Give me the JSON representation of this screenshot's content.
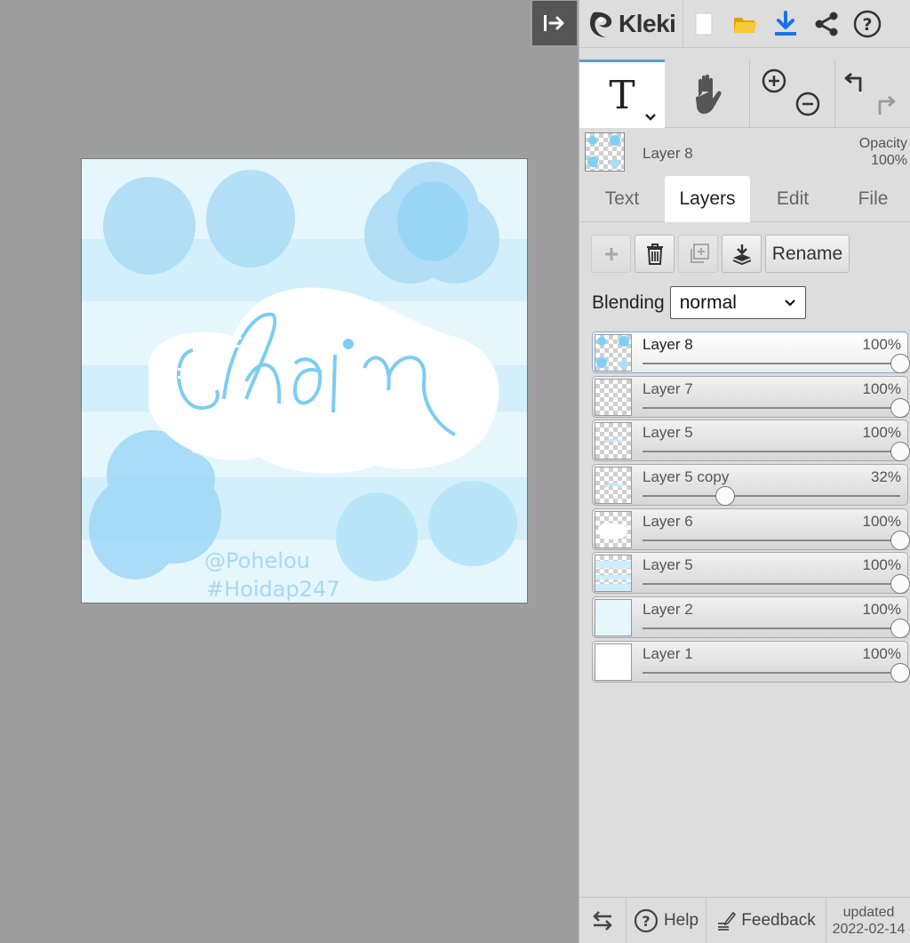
{
  "app": {
    "name": "Kleki"
  },
  "toolbar": {
    "active_tool": "T"
  },
  "layer_summary": {
    "name": "Layer 8",
    "opacity_label": "Opacity",
    "opacity_value": "100%"
  },
  "tabs": [
    {
      "label": "Text",
      "active": false
    },
    {
      "label": "Layers",
      "active": true
    },
    {
      "label": "Edit",
      "active": false
    },
    {
      "label": "File",
      "active": false
    }
  ],
  "layer_actions": {
    "rename_label": "Rename"
  },
  "blending": {
    "label": "Blending",
    "value": "normal"
  },
  "layers": [
    {
      "name": "Layer 8",
      "opacity": "100%",
      "level": 1.0,
      "active": true,
      "thumb": "dots"
    },
    {
      "name": "Layer 7",
      "opacity": "100%",
      "level": 1.0,
      "active": false,
      "thumb": "empty"
    },
    {
      "name": "Layer 5",
      "opacity": "100%",
      "level": 1.0,
      "active": false,
      "thumb": "faint"
    },
    {
      "name": "Layer 5 copy",
      "opacity": "32%",
      "level": 0.32,
      "active": false,
      "thumb": "faint"
    },
    {
      "name": "Layer 6",
      "opacity": "100%",
      "level": 1.0,
      "active": false,
      "thumb": "white"
    },
    {
      "name": "Layer 5",
      "opacity": "100%",
      "level": 1.0,
      "active": false,
      "thumb": "stripes"
    },
    {
      "name": "Layer 2",
      "opacity": "100%",
      "level": 1.0,
      "active": false,
      "thumb": "pale"
    },
    {
      "name": "Layer 1",
      "opacity": "100%",
      "level": 1.0,
      "active": false,
      "thumb": "solid-white"
    }
  ],
  "footer": {
    "help_label": "Help",
    "feedback_label": "Feedback",
    "updated_label": "updated",
    "updated_date": "2022-02-14"
  },
  "artwork": {
    "watermark_1": "@Pohelou",
    "watermark_2": "#Hoidap247"
  },
  "colors": {
    "accent": "#5b9bd5",
    "download": "#1a73e8",
    "folder": "#f4b400",
    "canvas_bg": "#e6f6fd",
    "stripe": "#d4f0fb",
    "blob": "#aee0f8",
    "blob_strong": "#7dd0f5"
  }
}
